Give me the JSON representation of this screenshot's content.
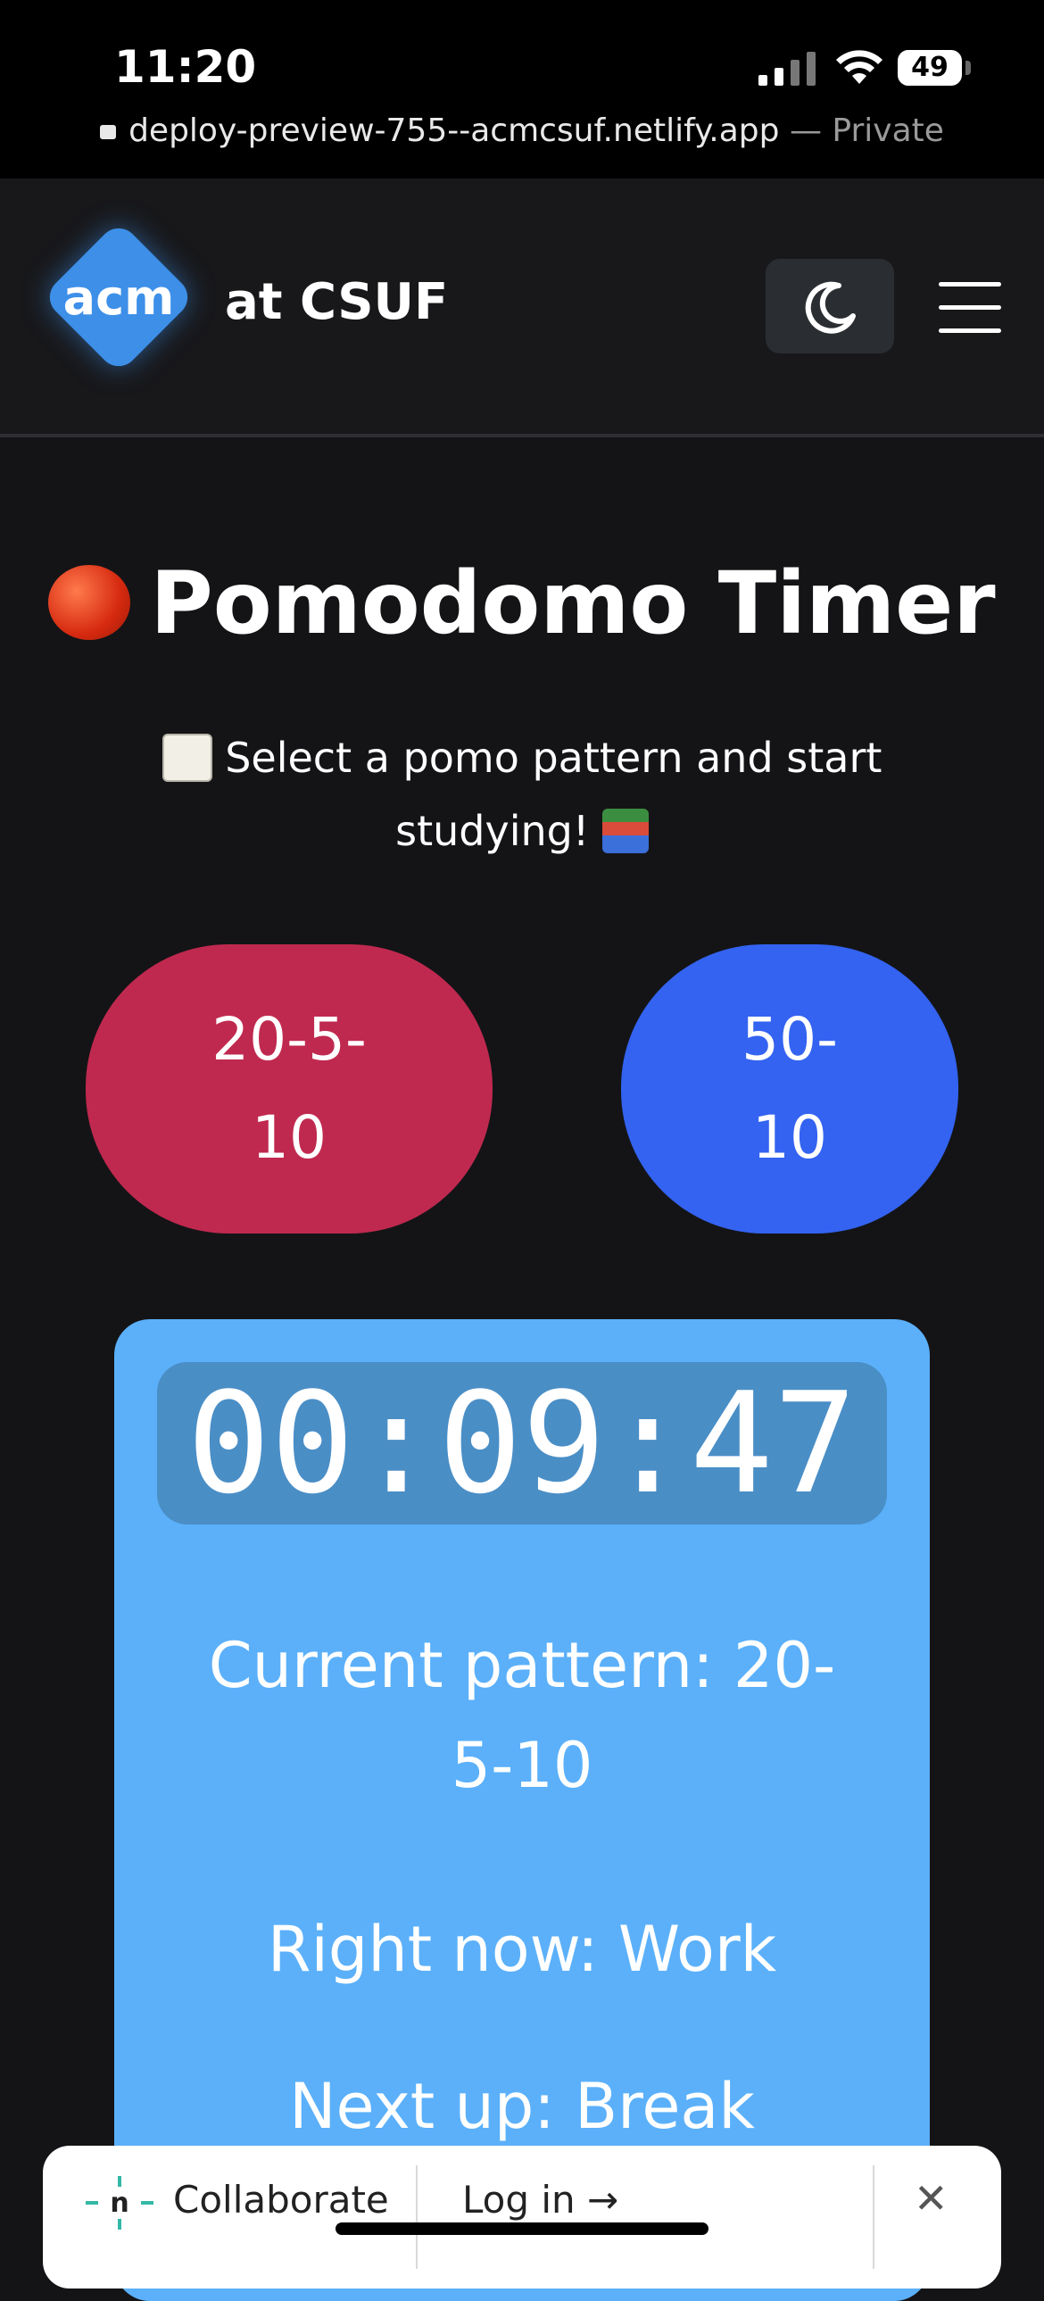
{
  "status_bar": {
    "time": "11:20",
    "battery": "49",
    "url": "deploy-preview-755--acmcsuf.netlify.app",
    "url_suffix": " — Private"
  },
  "header": {
    "logo_text": "acm",
    "org_text": "at CSUF",
    "theme_toggle_icon": "moon-icon",
    "menu_icon": "hamburger-menu-icon"
  },
  "main": {
    "title": "Pomodomo Timer",
    "subtitle_line1": "Select a pomo pattern and start",
    "subtitle_line2": "studying!",
    "patterns": [
      {
        "line1": "20-5-",
        "line2": "10",
        "color": "#c0294f"
      },
      {
        "line1": "50-",
        "line2": "10",
        "color": "#3363f0"
      }
    ]
  },
  "timer": {
    "display": "00:09:47",
    "current_pattern_line1": "Current pattern: 20-",
    "current_pattern_line2": "5-10",
    "right_now": "Right now: Work",
    "next_up": "Next up: Break"
  },
  "toolbar": {
    "collaborate": "Collaborate",
    "login": "Log in",
    "login_arrow": "→",
    "close": "✕"
  }
}
